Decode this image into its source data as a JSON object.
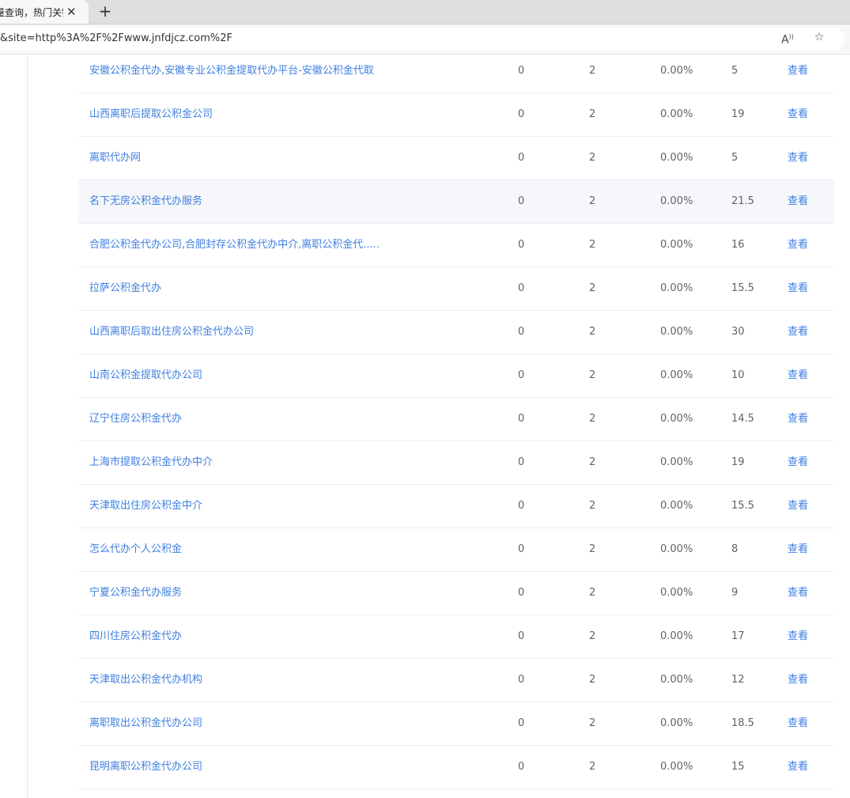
{
  "browser": {
    "tab_title": "量查询，热门关键",
    "url": "&site=http%3A%2F%2Fwww.jnfdjcz.com%2F"
  },
  "rows": [
    {
      "keyword": "安徽公积金代办,安徽专业公积金提取代办平台-安徽公积金代取",
      "a": "0",
      "b": "2",
      "c": "0.00%",
      "d": "5",
      "action": "查看"
    },
    {
      "keyword": "山西离职后提取公积金公司",
      "a": "0",
      "b": "2",
      "c": "0.00%",
      "d": "19",
      "action": "查看"
    },
    {
      "keyword": "离职代办网",
      "a": "0",
      "b": "2",
      "c": "0.00%",
      "d": "5",
      "action": "查看"
    },
    {
      "keyword": "名下无房公积金代办服务",
      "a": "0",
      "b": "2",
      "c": "0.00%",
      "d": "21.5",
      "action": "查看"
    },
    {
      "keyword": "合肥公积金代办公司,合肥封存公积金代办中介,离职公积金代.....",
      "a": "0",
      "b": "2",
      "c": "0.00%",
      "d": "16",
      "action": "查看"
    },
    {
      "keyword": "拉萨公积金代办",
      "a": "0",
      "b": "2",
      "c": "0.00%",
      "d": "15.5",
      "action": "查看"
    },
    {
      "keyword": "山西离职后取出住房公积金代办公司",
      "a": "0",
      "b": "2",
      "c": "0.00%",
      "d": "30",
      "action": "查看"
    },
    {
      "keyword": "山南公积金提取代办公司",
      "a": "0",
      "b": "2",
      "c": "0.00%",
      "d": "10",
      "action": "查看"
    },
    {
      "keyword": "辽宁住房公积金代办",
      "a": "0",
      "b": "2",
      "c": "0.00%",
      "d": "14.5",
      "action": "查看"
    },
    {
      "keyword": "上海市提取公积金代办中介",
      "a": "0",
      "b": "2",
      "c": "0.00%",
      "d": "19",
      "action": "查看"
    },
    {
      "keyword": "天津取出住房公积金中介",
      "a": "0",
      "b": "2",
      "c": "0.00%",
      "d": "15.5",
      "action": "查看"
    },
    {
      "keyword": "怎么代办个人公积金",
      "a": "0",
      "b": "2",
      "c": "0.00%",
      "d": "8",
      "action": "查看"
    },
    {
      "keyword": "宁夏公积金代办服务",
      "a": "0",
      "b": "2",
      "c": "0.00%",
      "d": "9",
      "action": "查看"
    },
    {
      "keyword": "四川住房公积金代办",
      "a": "0",
      "b": "2",
      "c": "0.00%",
      "d": "17",
      "action": "查看"
    },
    {
      "keyword": "天津取出公积金代办机构",
      "a": "0",
      "b": "2",
      "c": "0.00%",
      "d": "12",
      "action": "查看"
    },
    {
      "keyword": "离职取出公积金代办公司",
      "a": "0",
      "b": "2",
      "c": "0.00%",
      "d": "18.5",
      "action": "查看"
    },
    {
      "keyword": "昆明离职公积金代办公司",
      "a": "0",
      "b": "2",
      "c": "0.00%",
      "d": "15",
      "action": "查看"
    }
  ]
}
